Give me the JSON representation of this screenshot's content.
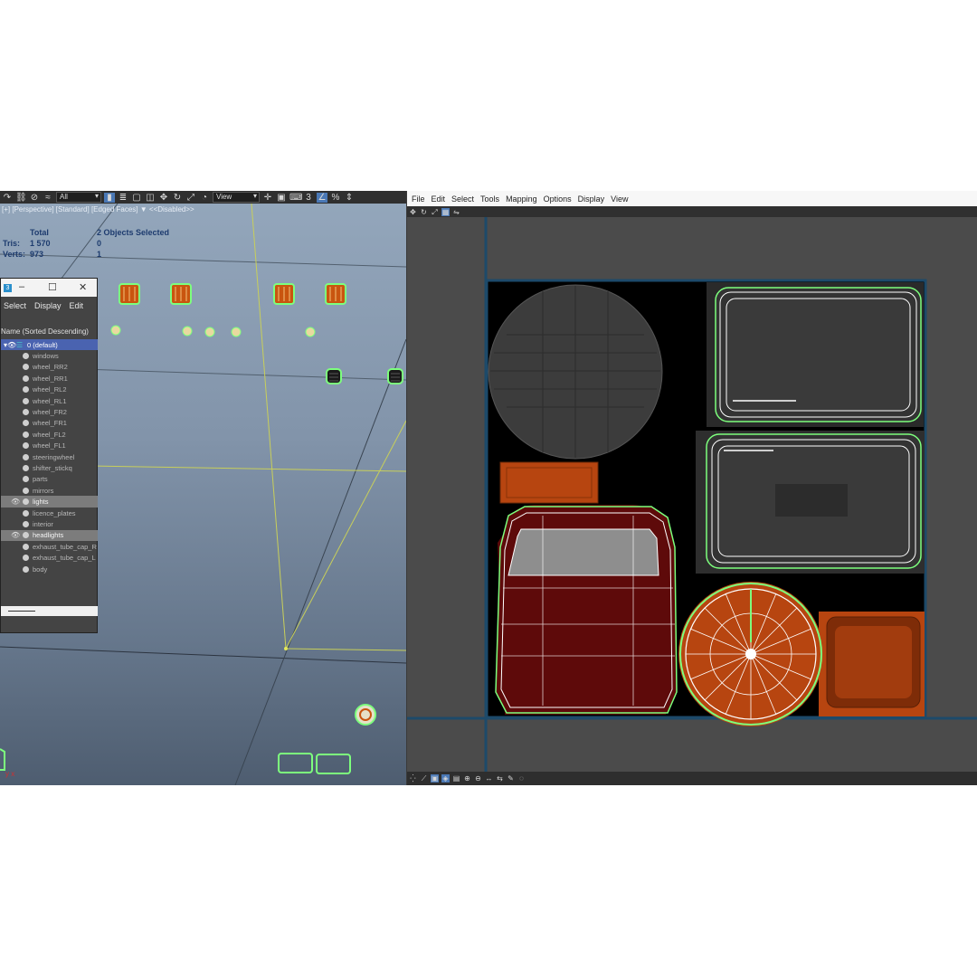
{
  "max": {
    "toolbar": {
      "selection_filter": "All",
      "ref_coord": "View",
      "snap_value": "3"
    },
    "viewport": {
      "label": "[+] [Perspective] [Standard] [Edged Faces]  ▼ <<Disabled>>",
      "stats": {
        "col_total": "Total",
        "col_selected": "2 Objects Selected",
        "tris_label": "Tris:",
        "tris_total": "1 570",
        "tris_selected": "0",
        "verts_label": "Verts:",
        "verts_total": "973",
        "verts_selected": "1"
      },
      "axis_label": "y x"
    },
    "explorer": {
      "menu": [
        "Select",
        "Display",
        "Edit"
      ],
      "column_header": "Name (Sorted Descending)",
      "root": "0 (default)",
      "items": [
        {
          "name": "windows",
          "visible": false,
          "selected": false
        },
        {
          "name": "wheel_RR2",
          "visible": false,
          "selected": false
        },
        {
          "name": "wheel_RR1",
          "visible": false,
          "selected": false
        },
        {
          "name": "wheel_RL2",
          "visible": false,
          "selected": false
        },
        {
          "name": "wheel_RL1",
          "visible": false,
          "selected": false
        },
        {
          "name": "wheel_FR2",
          "visible": false,
          "selected": false
        },
        {
          "name": "wheel_FR1",
          "visible": false,
          "selected": false
        },
        {
          "name": "wheel_FL2",
          "visible": false,
          "selected": false
        },
        {
          "name": "wheel_FL1",
          "visible": false,
          "selected": false
        },
        {
          "name": "steeringwheel",
          "visible": false,
          "selected": false
        },
        {
          "name": "shifter_stickq",
          "visible": false,
          "selected": false
        },
        {
          "name": "parts",
          "visible": false,
          "selected": false
        },
        {
          "name": "mirrors",
          "visible": false,
          "selected": false
        },
        {
          "name": "lights",
          "visible": true,
          "selected": true
        },
        {
          "name": "licence_plates",
          "visible": false,
          "selected": false
        },
        {
          "name": "interior",
          "visible": false,
          "selected": false
        },
        {
          "name": "headlights",
          "visible": true,
          "selected": true
        },
        {
          "name": "exhaust_tube_cap_R",
          "visible": false,
          "selected": false
        },
        {
          "name": "exhaust_tube_cap_L",
          "visible": false,
          "selected": false
        },
        {
          "name": "body",
          "visible": false,
          "selected": false
        }
      ]
    }
  },
  "uv_editor": {
    "menu": [
      "File",
      "Edit",
      "Select",
      "Tools",
      "Mapping",
      "Options",
      "Display",
      "View"
    ]
  },
  "colors": {
    "selection_green": "#5fd35f",
    "uv_wire": "#ffffff",
    "tile_border": "#1d4a6a",
    "dark_red": "#5a0808",
    "orange": "#b74510"
  }
}
